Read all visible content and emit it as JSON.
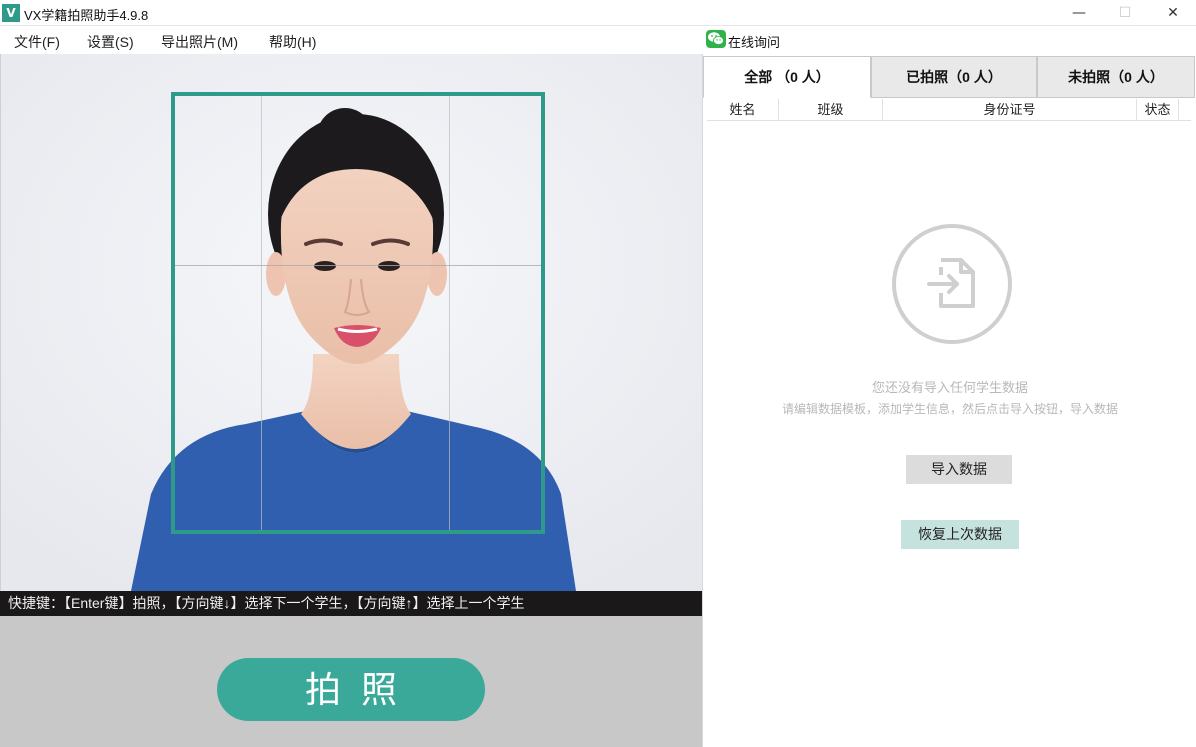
{
  "window": {
    "logo_text": "V",
    "title": "VX学籍拍照助手4.9.8",
    "min_label": "—",
    "max_label": "☐",
    "close_label": "✕"
  },
  "menu": {
    "items": [
      "文件(F)",
      "设置(S)",
      "导出照片(M)",
      "帮助(H)"
    ]
  },
  "wechat": {
    "label": "在线询问",
    "color": "#2fb24a"
  },
  "camera": {
    "shortcut_text": "快捷键：【Enter键】拍照，【方向键↓】选择下一个学生，【方向键↑】选择上一个学生",
    "capture_label": "拍照",
    "frame_color": "#2f9a8a",
    "button_color": "#3aa99a"
  },
  "tabs": [
    {
      "label": "全部 （0 人）",
      "active": true
    },
    {
      "label": "已拍照（0 人）",
      "active": false
    },
    {
      "label": "未拍照（0 人）",
      "active": false
    }
  ],
  "table": {
    "columns": [
      "姓名",
      "班级",
      "身份证号",
      "状态"
    ]
  },
  "empty_state": {
    "icon": "import-file-icon",
    "title": "您还没有导入任何学生数据",
    "description": "请编辑数据模板，添加学生信息，然后点击导入按钮，导入数据"
  },
  "actions": {
    "import_label": "导入数据",
    "restore_label": "恢复上次数据"
  }
}
